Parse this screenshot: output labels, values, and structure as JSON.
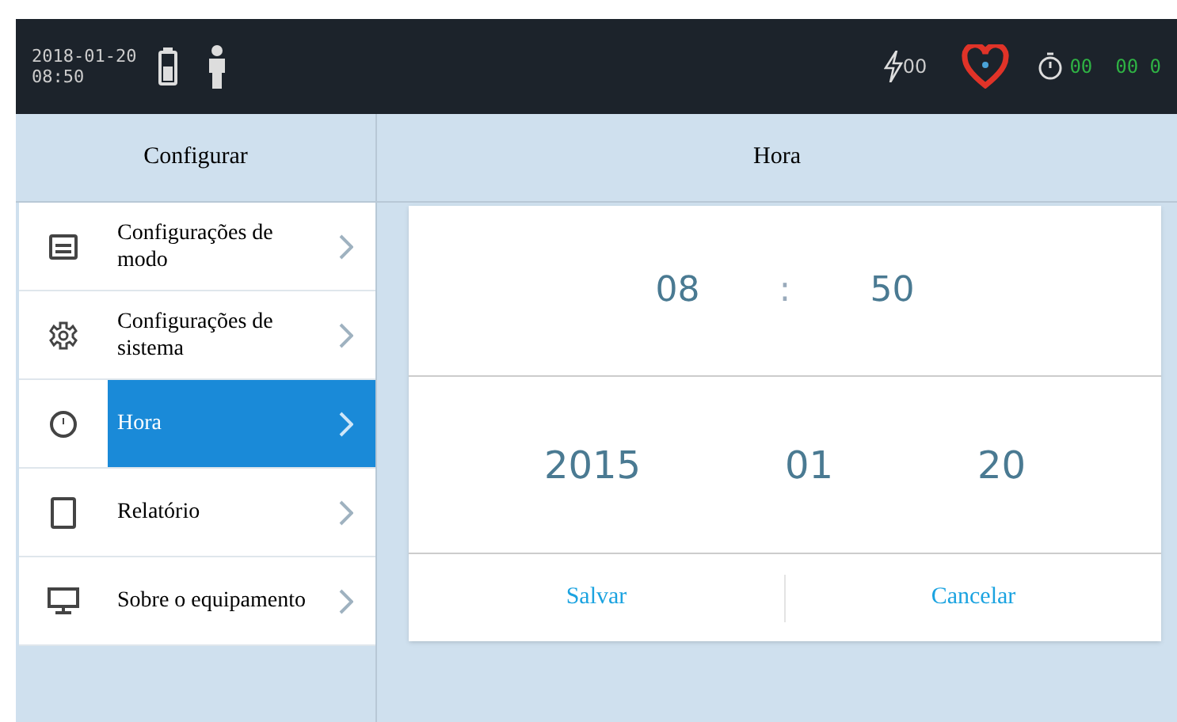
{
  "status_bar": {
    "date": "2018-01-20",
    "time": "08:50",
    "energy": "00",
    "timer": "00  00 0"
  },
  "sidebar": {
    "title": "Configurar",
    "items": [
      {
        "label": "Configurações de modo",
        "selected": false
      },
      {
        "label": "Configurações de sistema",
        "selected": false
      },
      {
        "label": "Hora",
        "selected": true
      },
      {
        "label": "Relatório",
        "selected": false
      },
      {
        "label": "Sobre o equipamento",
        "selected": false
      }
    ]
  },
  "panel": {
    "title": "Hora",
    "time": {
      "hour": "08",
      "separator": ":",
      "minute": "50"
    },
    "date": {
      "year": "2015",
      "month": "01",
      "day": "20"
    },
    "buttons": [
      "Salvar",
      "Cancelar"
    ]
  }
}
